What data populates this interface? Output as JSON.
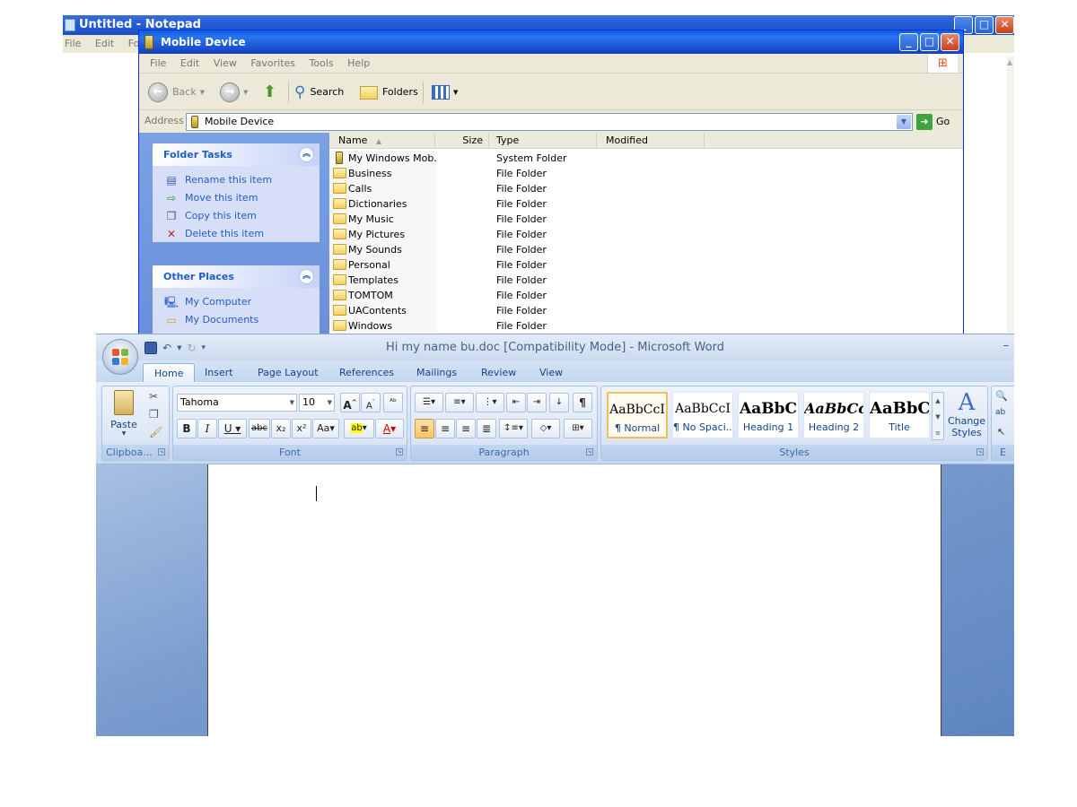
{
  "notepad": {
    "title": "Untitled - Notepad",
    "menu": [
      "File",
      "Edit",
      "Form"
    ]
  },
  "explorer": {
    "title": "Mobile Device",
    "menu": [
      "File",
      "Edit",
      "View",
      "Favorites",
      "Tools",
      "Help"
    ],
    "toolbar": {
      "back": "Back",
      "search": "Search",
      "folders": "Folders"
    },
    "address": {
      "label": "Address",
      "value": "Mobile Device",
      "go": "Go"
    },
    "folder_tasks": {
      "title": "Folder Tasks",
      "items": [
        "Rename this item",
        "Move this item",
        "Copy this item",
        "Delete this item"
      ]
    },
    "other_places": {
      "title": "Other Places",
      "items": [
        "My Computer",
        "My Documents"
      ]
    },
    "columns": {
      "name": "Name",
      "size": "Size",
      "type": "Type",
      "modified": "Modified"
    },
    "files": [
      {
        "name": "My Windows Mob...",
        "type": "System Folder"
      },
      {
        "name": "Business",
        "type": "File Folder"
      },
      {
        "name": "Calls",
        "type": "File Folder"
      },
      {
        "name": "Dictionaries",
        "type": "File Folder"
      },
      {
        "name": "My Music",
        "type": "File Folder"
      },
      {
        "name": "My Pictures",
        "type": "File Folder"
      },
      {
        "name": "My Sounds",
        "type": "File Folder"
      },
      {
        "name": "Personal",
        "type": "File Folder"
      },
      {
        "name": "Templates",
        "type": "File Folder"
      },
      {
        "name": "TOMTOM",
        "type": "File Folder"
      },
      {
        "name": "UAContents",
        "type": "File Folder"
      },
      {
        "name": "Windows",
        "type": "File Folder"
      }
    ]
  },
  "word": {
    "title": "Hi my name bu.doc [Compatibility Mode] - Microsoft Word",
    "tabs": [
      "Home",
      "Insert",
      "Page Layout",
      "References",
      "Mailings",
      "Review",
      "View"
    ],
    "clipboard": {
      "paste": "Paste",
      "label": "Clipboa..."
    },
    "font": {
      "name": "Tahoma",
      "size": "10",
      "label": "Font"
    },
    "paragraph": {
      "label": "Paragraph"
    },
    "styles": {
      "label": "Styles",
      "tiles": [
        {
          "sample": "AaBbCcI",
          "name": "¶ Normal"
        },
        {
          "sample": "AaBbCcI",
          "name": "¶ No Spaci..."
        },
        {
          "sample": "AaBbC",
          "name": "Heading 1"
        },
        {
          "sample": "AaBbCc",
          "name": "Heading 2"
        },
        {
          "sample": "AaBbC",
          "name": "Title"
        }
      ],
      "change_line1": "Change",
      "change_line2": "Styles"
    },
    "editing": {
      "label": "E"
    }
  }
}
